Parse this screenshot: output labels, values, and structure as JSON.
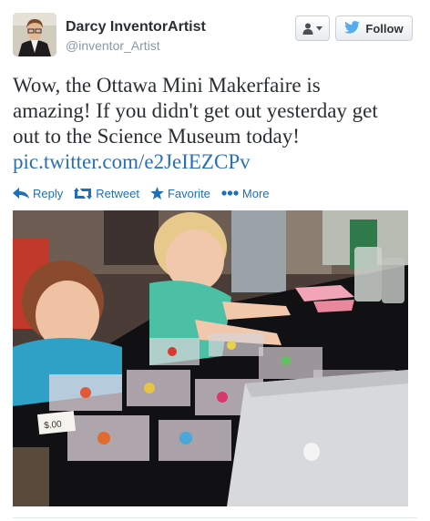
{
  "user": {
    "name": "Darcy InventorArtist",
    "handle": "@inventor_Artist"
  },
  "header_buttons": {
    "follow_label": "Follow"
  },
  "tweet": {
    "text_lines": [
      "Wow, the Ottawa Mini Makerfaire is",
      "amazing! If you didn't get out yesterday get",
      "out to the Science Museum today!"
    ],
    "link": "pic.twitter.com/e2JeIEZCPv"
  },
  "actions": {
    "reply": "Reply",
    "retweet": "Retweet",
    "favorite": "Favorite",
    "more": "More"
  },
  "photo": {
    "tag_text": "$.00"
  },
  "colors": {
    "link": "#2a6fb5",
    "action": "#1e6fb8",
    "twitter_bird": "#55acee"
  },
  "icons": [
    "person-dropdown-icon",
    "twitter-bird-icon",
    "reply-arrow-icon",
    "retweet-icon",
    "star-icon",
    "more-dots-icon"
  ]
}
